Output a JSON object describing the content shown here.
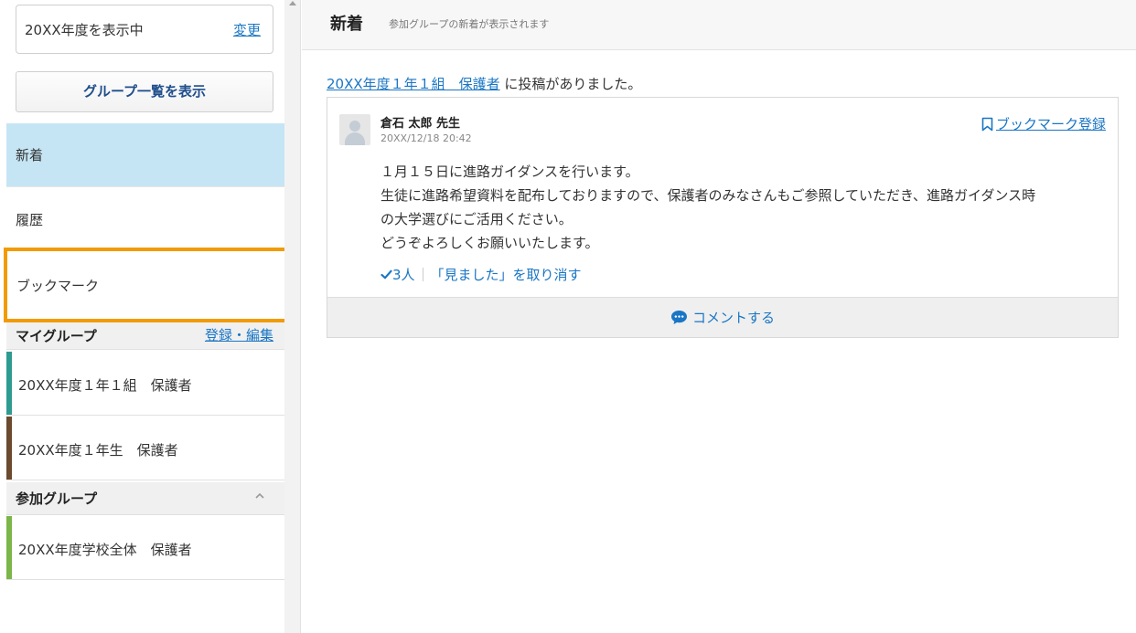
{
  "sidebar": {
    "year_label": "20XX年度を表示中",
    "change_link": "変更",
    "group_list_button": "グループ一覧を表示",
    "nav": {
      "new": "新着",
      "history": "履歴",
      "bookmark": "ブックマーク"
    },
    "my_groups": {
      "title": "マイグループ",
      "edit_link": "登録・編集",
      "items": [
        {
          "label": "20XX年度１年１組　保護者",
          "color": "#2e9b90"
        },
        {
          "label": "20XX年度１年生　保護者",
          "color": "#6b4a2e"
        }
      ]
    },
    "joined_groups": {
      "title": "参加グループ",
      "collapse_icon": "chevron-up-icon",
      "items": [
        {
          "label": "20XX年度学校全体　保護者",
          "color": "#7ab648"
        }
      ]
    }
  },
  "main": {
    "header": {
      "title": "新着",
      "subtitle": "参加グループの新着が表示されます"
    },
    "notice": {
      "group_link": "20XX年度１年１組　保護者",
      "suffix": " に投稿がありました。"
    },
    "post": {
      "author": "倉石 太郎 先生",
      "timestamp": "20XX/12/18 20:42",
      "bookmark_label": "ブックマーク登録",
      "body_lines": [
        "１月１５日に進路ガイダンスを行います。",
        "生徒に進路希望資料を配布しておりますので、保護者のみなさんもご参照していただき、進路ガイダンス時",
        "の大学選びにご活用ください。",
        "どうぞよろしくお願いいたします。"
      ],
      "seen_count": "3人",
      "undo_seen_label": "「見ました」を取り消す",
      "comment_label": "コメントする"
    }
  },
  "colors": {
    "accent_link": "#1a76c4",
    "active_nav_bg": "#c5e5f4",
    "highlight_border": "#f19b00"
  }
}
